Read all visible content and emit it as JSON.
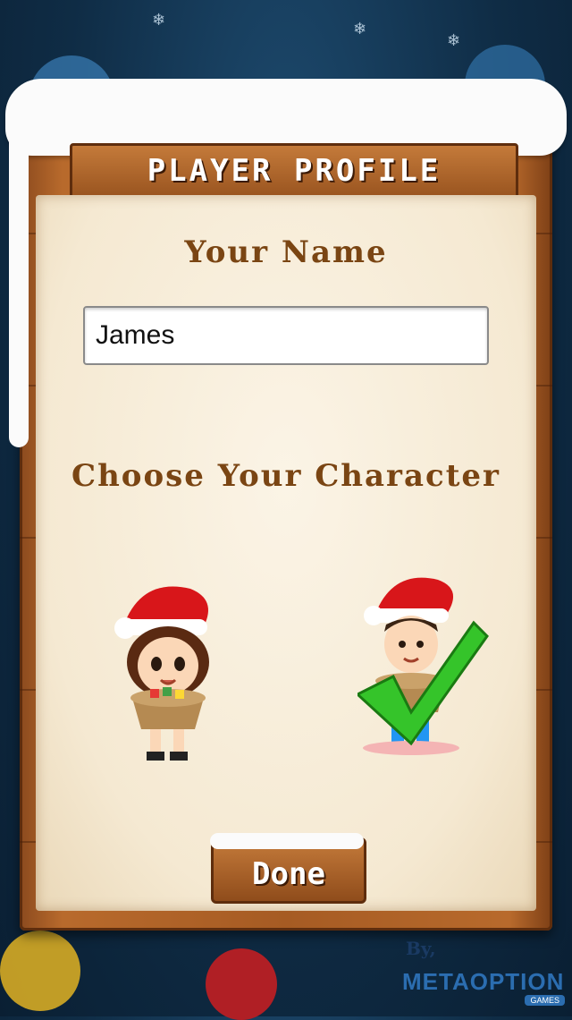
{
  "title": "PLAYER PROFILE",
  "name_section": {
    "label": "Your Name",
    "value": "James"
  },
  "character_section": {
    "label": "Choose Your Character",
    "characters": [
      {
        "id": "girl",
        "selected": false
      },
      {
        "id": "boy",
        "selected": true
      }
    ]
  },
  "done_button": {
    "label": "Done"
  },
  "branding": {
    "by": "By,",
    "name": "METAOPTION",
    "sub": "GAMES"
  },
  "colors": {
    "wood": "#a65b23",
    "paper": "#f8efdd",
    "label": "#7a4513",
    "check": "#35c42a",
    "hat": "#d8161a"
  }
}
